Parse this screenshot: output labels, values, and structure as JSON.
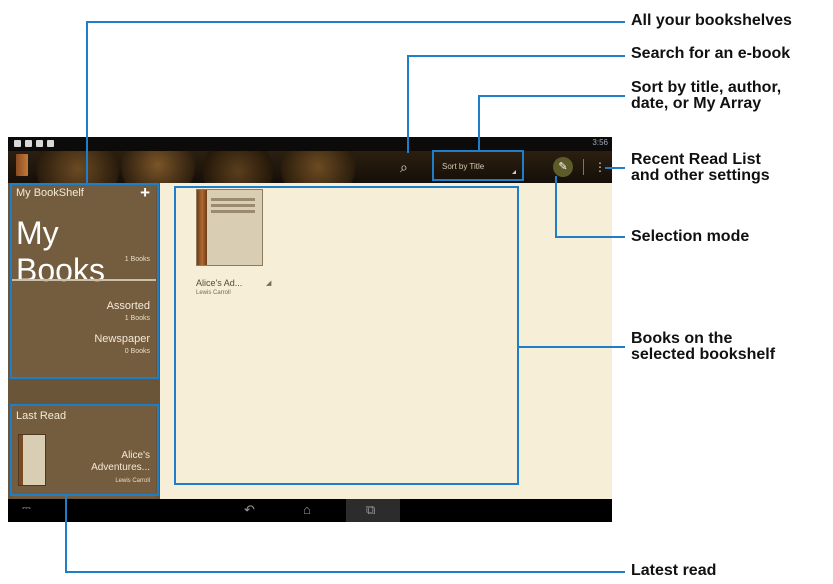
{
  "annotations": {
    "all_bookshelves": "All your bookshelves",
    "search": "Search for an e-book",
    "sort_line1": "Sort by title, author,",
    "sort_line2": "date, or My Array",
    "recent_line1": "Recent Read List",
    "recent_line2": "and other settings",
    "selection_mode": "Selection mode",
    "books_line1": "Books on the",
    "books_line2": "selected bookshelf",
    "latest_read": "Latest read"
  },
  "app": {
    "status_time": "3:56",
    "sort_label": "Sort by Title",
    "icons": {
      "search": "search-icon",
      "pencil": "pencil-icon",
      "menu": "overflow-menu-icon",
      "add": "plus-icon",
      "back": "back-icon",
      "home": "home-icon",
      "recent": "recent-apps-icon"
    }
  },
  "sidebar": {
    "shelf_title": "My BookShelf",
    "add_label": "+",
    "current_shelf": "My Books",
    "current_count": "1 Books",
    "shelves": [
      {
        "name": "Assorted",
        "count": "1 Books"
      },
      {
        "name": "Newspaper",
        "count": "0 Books"
      }
    ],
    "last_read": {
      "title": "Last Read",
      "book_line1": "Alice's",
      "book_line2": "Adventures...",
      "author": "Lewis Carroll"
    }
  },
  "main": {
    "books": [
      {
        "title": "Alice's Ad...",
        "author": "Lewis Carroll"
      }
    ]
  },
  "colors": {
    "annotation_blue": "#1e7fc8",
    "sidebar_brown": "#745c3e",
    "main_bg": "#f6eed7"
  }
}
